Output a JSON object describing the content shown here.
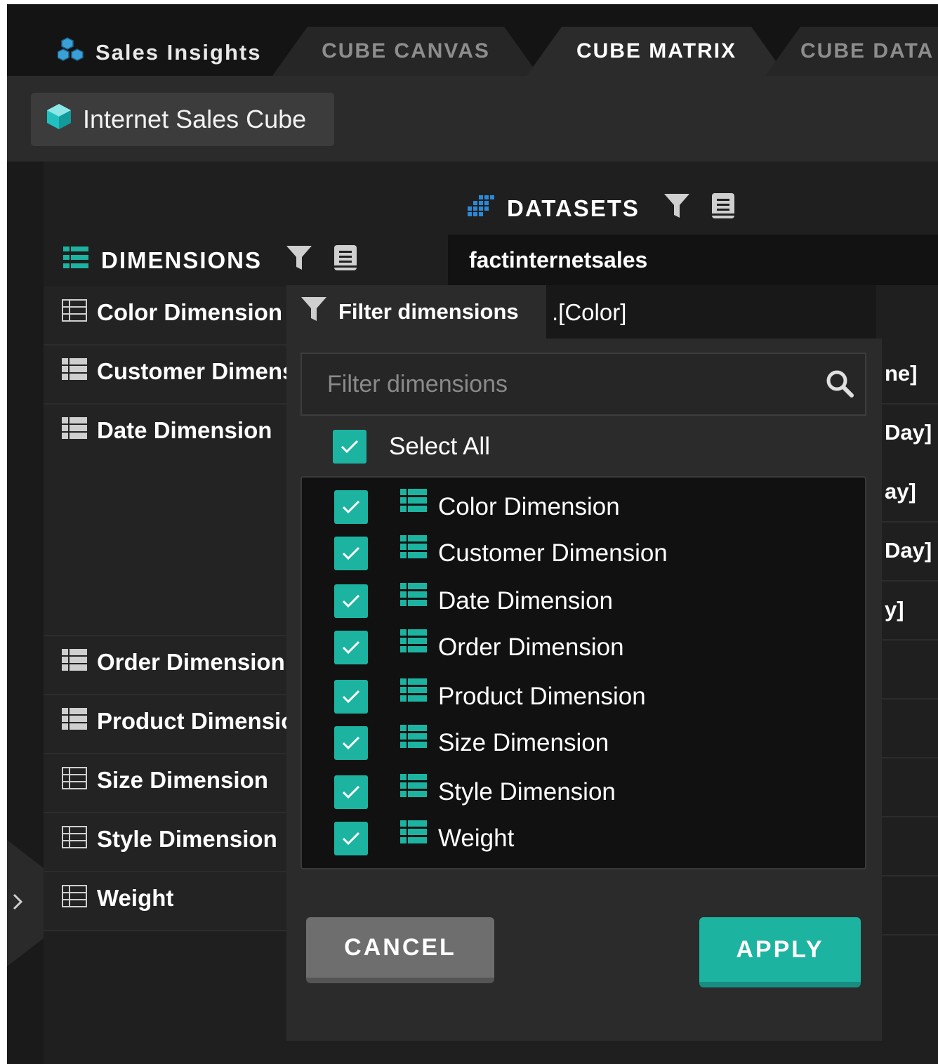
{
  "app": {
    "title": "Sales Insights"
  },
  "tabs": [
    {
      "label": "CUBE CANVAS",
      "active": false
    },
    {
      "label": "CUBE MATRIX",
      "active": true
    },
    {
      "label": "CUBE DATA",
      "active": false
    }
  ],
  "cube": {
    "name": "Internet Sales Cube"
  },
  "dimensions_header": {
    "title": "DIMENSIONS"
  },
  "datasets_header": {
    "title": "DATASETS"
  },
  "dataset": {
    "name": "factinternetsales"
  },
  "dimension_list": [
    {
      "label": "Color Dimension"
    },
    {
      "label": "Customer Dimension"
    },
    {
      "label": "Date Dimension"
    },
    {
      "label": "Order Dimension"
    },
    {
      "label": "Product Dimension"
    },
    {
      "label": "Size Dimension"
    },
    {
      "label": "Style Dimension"
    },
    {
      "label": "Weight"
    }
  ],
  "matrix_cells": {
    "color_cell": ".[Color]",
    "partial": [
      "ne]",
      " Day]",
      "ay]",
      "Day]",
      "y]"
    ]
  },
  "filter_popup": {
    "title": "Filter dimensions",
    "search_placeholder": "Filter dimensions",
    "select_all_label": "Select All",
    "options": [
      {
        "label": "Color Dimension",
        "checked": true
      },
      {
        "label": "Customer Dimension",
        "checked": true
      },
      {
        "label": "Date Dimension",
        "checked": true
      },
      {
        "label": "Order Dimension",
        "checked": true
      },
      {
        "label": "Product Dimension",
        "checked": true
      },
      {
        "label": "Size Dimension",
        "checked": true
      },
      {
        "label": "Style Dimension",
        "checked": true
      },
      {
        "label": "Weight",
        "checked": true
      }
    ],
    "cancel_label": "CANCEL",
    "apply_label": "APPLY"
  },
  "colors": {
    "accent": "#1db3a1",
    "background": "#1f1f1f",
    "topbar": "#141414"
  }
}
